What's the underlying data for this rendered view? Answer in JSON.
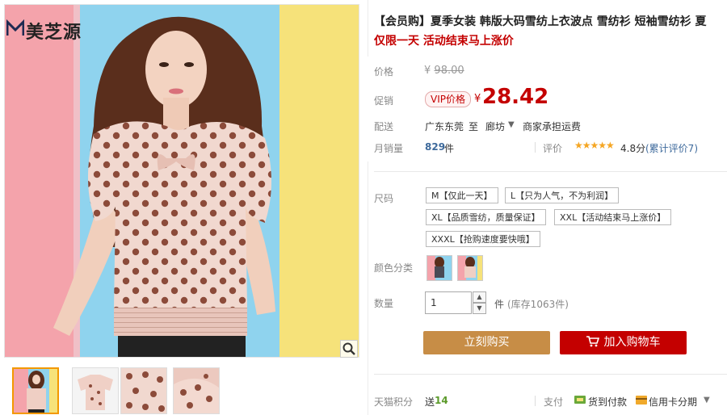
{
  "brand": {
    "logo_text": "美芝源",
    "logo_mark": "M",
    "logo_small": "zhiyuan"
  },
  "product": {
    "title": "【会员购】夏季女装 韩版大码雪纺上衣波点 雪纺衫 短袖雪纺衫 夏",
    "promo": "仅限一天 活动结束马上涨价"
  },
  "price": {
    "label": "价格",
    "currency": "¥",
    "original": "98.00",
    "promo_label": "促销",
    "vip_badge": "VIP价格",
    "current": "28.42"
  },
  "shipping": {
    "label": "配送",
    "from": "广东东莞",
    "to_word": "至",
    "destination": "廊坊",
    "fee": "商家承担运费"
  },
  "sales": {
    "label": "月销量",
    "count": "829",
    "unit": "件",
    "rating_label": "评价",
    "stars": "★★★★★",
    "rating_value": 4.8,
    "score": "4.8分",
    "review_link": "(累计评价7)"
  },
  "sizes": {
    "label": "尺码",
    "options": [
      "M【仅此一天】",
      "L【只为人气，不为利润】",
      "XL【品质雪纺，质量保证】",
      "XXL【活动结束马上涨价】",
      "XXXL【抢购速度要快哦】"
    ]
  },
  "colors": {
    "label": "颜色分类",
    "swatch_count": 2
  },
  "quantity": {
    "label": "数量",
    "value": "1",
    "unit": "件",
    "stock": "(库存1063件)"
  },
  "actions": {
    "buy_now": "立刻购买",
    "add_cart": "加入购物车"
  },
  "points": {
    "label": "天猫积分",
    "prefix": "送",
    "value": "14"
  },
  "payment": {
    "label": "支付",
    "cod": "货到付款",
    "credit": "信用卡分期"
  },
  "icons": {
    "zoom": "magnifier-icon",
    "cart": "shopping-cart-icon",
    "cod": "cash-icon",
    "card": "credit-card-icon",
    "dropdown": "caret-down-icon"
  },
  "colors_theme": {
    "price_red": "#c40000",
    "buy_orange": "#c78d46",
    "cart_red": "#c40000",
    "link_blue": "#3e6a9c",
    "points_green": "#5b9a2a",
    "star_gold": "#f5a623"
  }
}
